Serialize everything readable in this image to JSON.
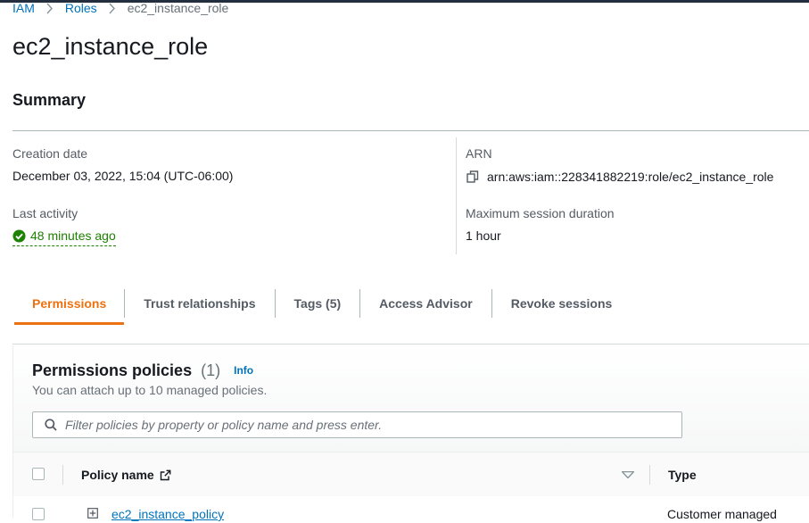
{
  "breadcrumb": {
    "items": [
      "IAM",
      "Roles"
    ],
    "current": "ec2_instance_role"
  },
  "page": {
    "title": "ec2_instance_role"
  },
  "summary": {
    "title": "Summary",
    "creation_date_label": "Creation date",
    "creation_date": "December 03, 2022, 15:04 (UTC-06:00)",
    "last_activity_label": "Last activity",
    "last_activity": "48 minutes ago",
    "arn_label": "ARN",
    "arn": "arn:aws:iam::228341882219:role/ec2_instance_role",
    "max_session_label": "Maximum session duration",
    "max_session": "1 hour"
  },
  "tabs": [
    "Permissions",
    "Trust relationships",
    "Tags (5)",
    "Access Advisor",
    "Revoke sessions"
  ],
  "permissions": {
    "title": "Permissions policies",
    "count": "(1)",
    "info": "Info",
    "description": "You can attach up to 10 managed policies.",
    "filter_placeholder": "Filter policies by property or policy name and press enter.",
    "columns": {
      "policy_name": "Policy name",
      "type": "Type"
    },
    "rows": [
      {
        "name": "ec2_instance_policy",
        "type": "Customer managed"
      }
    ]
  },
  "colors": {
    "link": "#0073bb",
    "active_tab": "#ec7211",
    "success": "#1d8102",
    "header_bar": "#232f3e"
  },
  "icons": [
    "chevron-right-icon",
    "check-circle-icon",
    "copy-icon",
    "search-icon",
    "external-link-icon",
    "sort-down-icon",
    "expand-plus-icon"
  ]
}
